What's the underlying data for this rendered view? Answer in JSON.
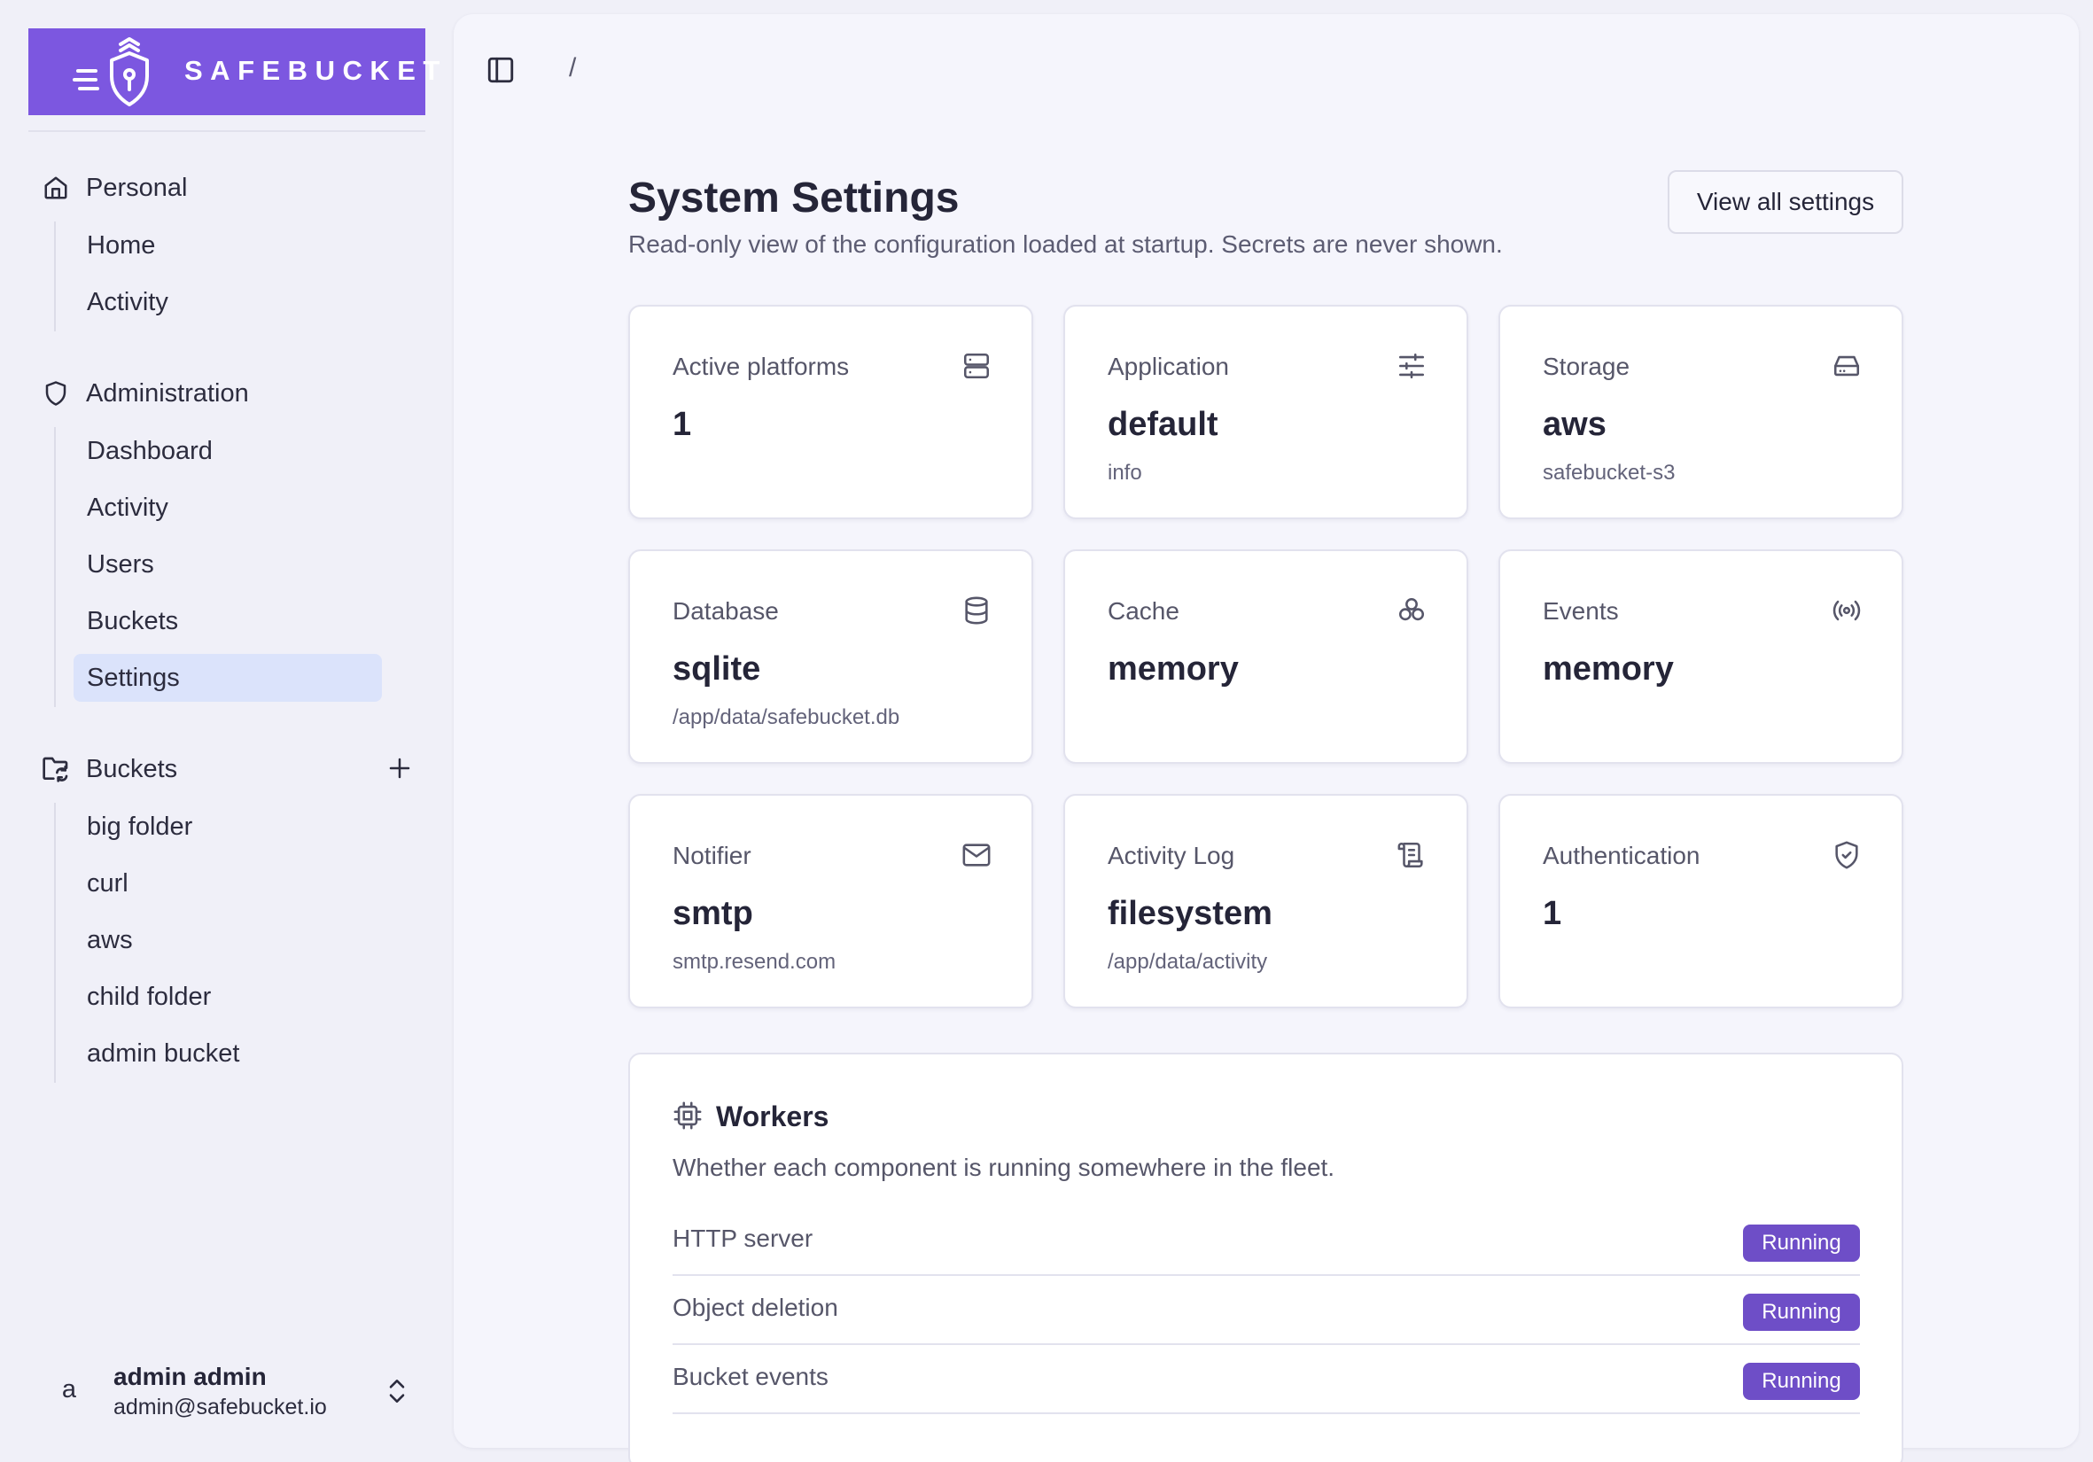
{
  "brand": {
    "name": "SAFEBUCKET",
    "color": "#7c57e0"
  },
  "sidebar": {
    "groups": [
      {
        "label": "Personal",
        "icon": "home-icon",
        "items": [
          {
            "label": "Home"
          },
          {
            "label": "Activity"
          }
        ]
      },
      {
        "label": "Administration",
        "icon": "shield-icon",
        "items": [
          {
            "label": "Dashboard"
          },
          {
            "label": "Activity"
          },
          {
            "label": "Users"
          },
          {
            "label": "Buckets"
          },
          {
            "label": "Settings",
            "active": true
          }
        ]
      },
      {
        "label": "Buckets",
        "icon": "folder-sync-icon",
        "items": [
          {
            "label": "big folder"
          },
          {
            "label": "curl"
          },
          {
            "label": "aws"
          },
          {
            "label": "child folder"
          },
          {
            "label": "admin bucket"
          }
        ]
      }
    ]
  },
  "user": {
    "avatar": "a",
    "name": "admin admin",
    "email": "admin@safebucket.io"
  },
  "header": {
    "breadcrumb": "/"
  },
  "page": {
    "title": "System Settings",
    "subtitle": "Read-only view of the configuration loaded at startup. Secrets are never shown.",
    "view_all_label": "View all settings"
  },
  "cards": [
    {
      "label": "Active platforms",
      "value": "1",
      "sub": "",
      "icon": "server-icon"
    },
    {
      "label": "Application",
      "value": "default",
      "sub": "info",
      "icon": "sliders-icon"
    },
    {
      "label": "Storage",
      "value": "aws",
      "sub": "safebucket-s3",
      "icon": "hard-drive-icon"
    },
    {
      "label": "Database",
      "value": "sqlite",
      "sub": "/app/data/safebucket.db",
      "icon": "database-icon"
    },
    {
      "label": "Cache",
      "value": "memory",
      "sub": "",
      "icon": "cluster-icon"
    },
    {
      "label": "Events",
      "value": "memory",
      "sub": "",
      "icon": "broadcast-icon"
    },
    {
      "label": "Notifier",
      "value": "smtp",
      "sub": "smtp.resend.com",
      "icon": "mail-icon"
    },
    {
      "label": "Activity Log",
      "value": "filesystem",
      "sub": "/app/data/activity",
      "icon": "scroll-icon"
    },
    {
      "label": "Authentication",
      "value": "1",
      "sub": "",
      "icon": "shield-check-icon"
    }
  ],
  "workers": {
    "title": "Workers",
    "description": "Whether each component is running somewhere in the fleet.",
    "rows": [
      {
        "name": "HTTP server",
        "status": "Running"
      },
      {
        "name": "Object deletion",
        "status": "Running"
      },
      {
        "name": "Bucket events",
        "status": "Running"
      }
    ],
    "badge_color": "#6e4ec7"
  }
}
